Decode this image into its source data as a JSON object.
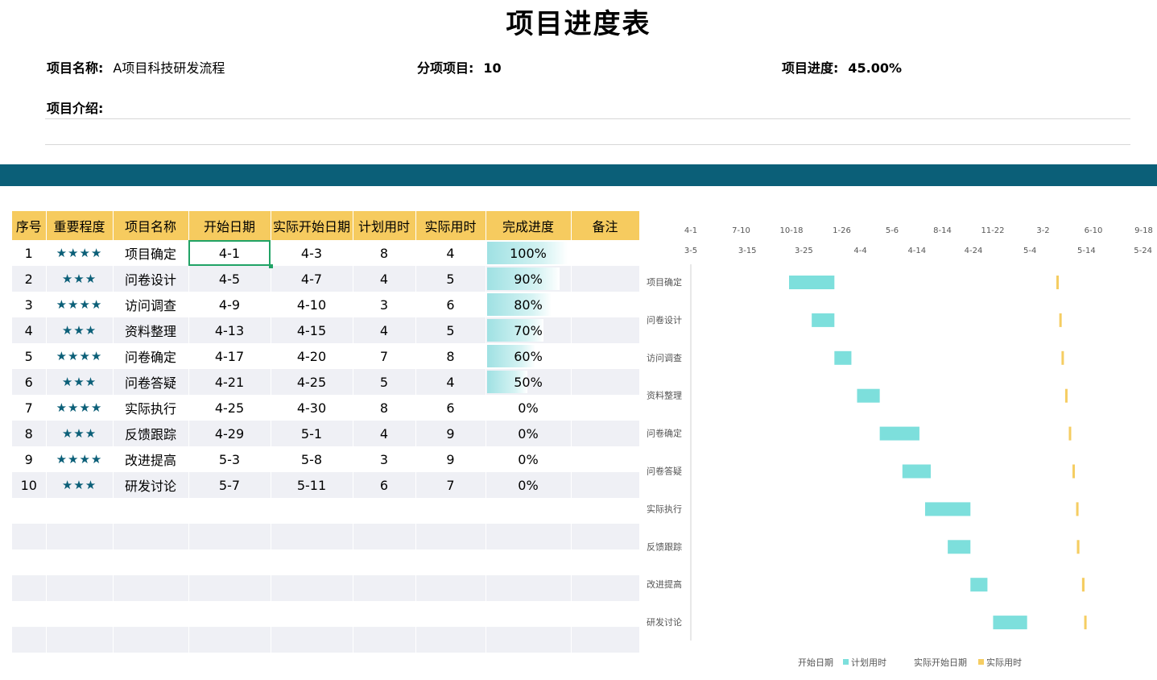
{
  "title": "项目进度表",
  "project": {
    "name_label": "项目名称:",
    "name_value": "A项目科技研发流程",
    "sub_label": "分项项目:",
    "sub_value": "10",
    "progress_label": "项目进度:",
    "progress_value": "45.00%",
    "intro_label": "项目介绍:"
  },
  "table": {
    "headers": [
      "序号",
      "重要程度",
      "项目名称",
      "开始日期",
      "实际开始日期",
      "计划用时",
      "实际用时",
      "完成进度",
      "备注"
    ],
    "rows": [
      {
        "no": "1",
        "stars": "★★★★",
        "name": "项目确定",
        "start": "4-1",
        "actual_start": "4-3",
        "plan": "8",
        "actual": "4",
        "progress": "100%",
        "progress_fraction": 1.0,
        "note": ""
      },
      {
        "no": "2",
        "stars": "★★★",
        "name": "问卷设计",
        "start": "4-5",
        "actual_start": "4-7",
        "plan": "4",
        "actual": "5",
        "progress": "90%",
        "progress_fraction": 0.9,
        "note": ""
      },
      {
        "no": "3",
        "stars": "★★★★",
        "name": "访问调查",
        "start": "4-9",
        "actual_start": "4-10",
        "plan": "3",
        "actual": "6",
        "progress": "80%",
        "progress_fraction": 0.8,
        "note": ""
      },
      {
        "no": "4",
        "stars": "★★★",
        "name": "资料整理",
        "start": "4-13",
        "actual_start": "4-15",
        "plan": "4",
        "actual": "5",
        "progress": "70%",
        "progress_fraction": 0.7,
        "note": ""
      },
      {
        "no": "5",
        "stars": "★★★★",
        "name": "问卷确定",
        "start": "4-17",
        "actual_start": "4-20",
        "plan": "7",
        "actual": "8",
        "progress": "60%",
        "progress_fraction": 0.6,
        "note": ""
      },
      {
        "no": "6",
        "stars": "★★★",
        "name": "问卷答疑",
        "start": "4-21",
        "actual_start": "4-25",
        "plan": "5",
        "actual": "4",
        "progress": "50%",
        "progress_fraction": 0.5,
        "note": ""
      },
      {
        "no": "7",
        "stars": "★★★★",
        "name": "实际执行",
        "start": "4-25",
        "actual_start": "4-30",
        "plan": "8",
        "actual": "6",
        "progress": "0%",
        "progress_fraction": 0,
        "note": ""
      },
      {
        "no": "8",
        "stars": "★★★",
        "name": "反馈跟踪",
        "start": "4-29",
        "actual_start": "5-1",
        "plan": "4",
        "actual": "9",
        "progress": "0%",
        "progress_fraction": 0,
        "note": ""
      },
      {
        "no": "9",
        "stars": "★★★★",
        "name": "改进提高",
        "start": "5-3",
        "actual_start": "5-8",
        "plan": "3",
        "actual": "9",
        "progress": "0%",
        "progress_fraction": 0,
        "note": ""
      },
      {
        "no": "10",
        "stars": "★★★",
        "name": "研发讨论",
        "start": "5-7",
        "actual_start": "5-11",
        "plan": "6",
        "actual": "7",
        "progress": "0%",
        "progress_fraction": 0,
        "note": ""
      }
    ],
    "empty_rows": 6
  },
  "colors": {
    "band": "#0b5f78",
    "header": "#f6cb5f",
    "plan_bar": "#7ddfdc",
    "actual_bar": "#f5cd62",
    "stars": "#0b5f78",
    "selection": "#21a366"
  },
  "chart_data": {
    "type": "bar",
    "orientation": "horizontal-stacked",
    "categories": [
      "项目确定",
      "问卷设计",
      "访问调查",
      "资料整理",
      "问卷确定",
      "问卷答疑",
      "实际执行",
      "反馈跟踪",
      "改进提高",
      "研发讨论"
    ],
    "top_axis_labels_row1": [
      "4-1",
      "7-10",
      "10-18",
      "1-26",
      "5-6",
      "8-14",
      "11-22",
      "3-2",
      "6-10",
      "9-18"
    ],
    "top_axis_labels_row2": [
      "3-5",
      "3-15",
      "3-25",
      "4-4",
      "4-14",
      "4-24",
      "5-4",
      "5-14",
      "5-24"
    ],
    "series_main": [
      {
        "name": "开始日期",
        "visible": false,
        "values": [
          "4-1",
          "4-5",
          "4-9",
          "4-13",
          "4-17",
          "4-21",
          "4-25",
          "4-29",
          "5-3",
          "5-7"
        ]
      },
      {
        "name": "计划用时",
        "color": "#7ddfdc",
        "values": [
          8,
          4,
          3,
          4,
          7,
          5,
          8,
          4,
          3,
          6
        ]
      }
    ],
    "series_secondary": [
      {
        "name": "实际开始日期",
        "visible": false,
        "values": [
          "4-3",
          "4-7",
          "4-10",
          "4-15",
          "4-20",
          "4-25",
          "4-30",
          "5-1",
          "5-8",
          "5-11"
        ]
      },
      {
        "name": "实际用时",
        "color": "#f5cd62",
        "values": [
          4,
          5,
          6,
          5,
          8,
          4,
          6,
          9,
          9,
          7
        ]
      }
    ],
    "legend": [
      "开始日期",
      "计划用时",
      "实际开始日期",
      "实际用时"
    ],
    "legend_position": "bottom"
  }
}
